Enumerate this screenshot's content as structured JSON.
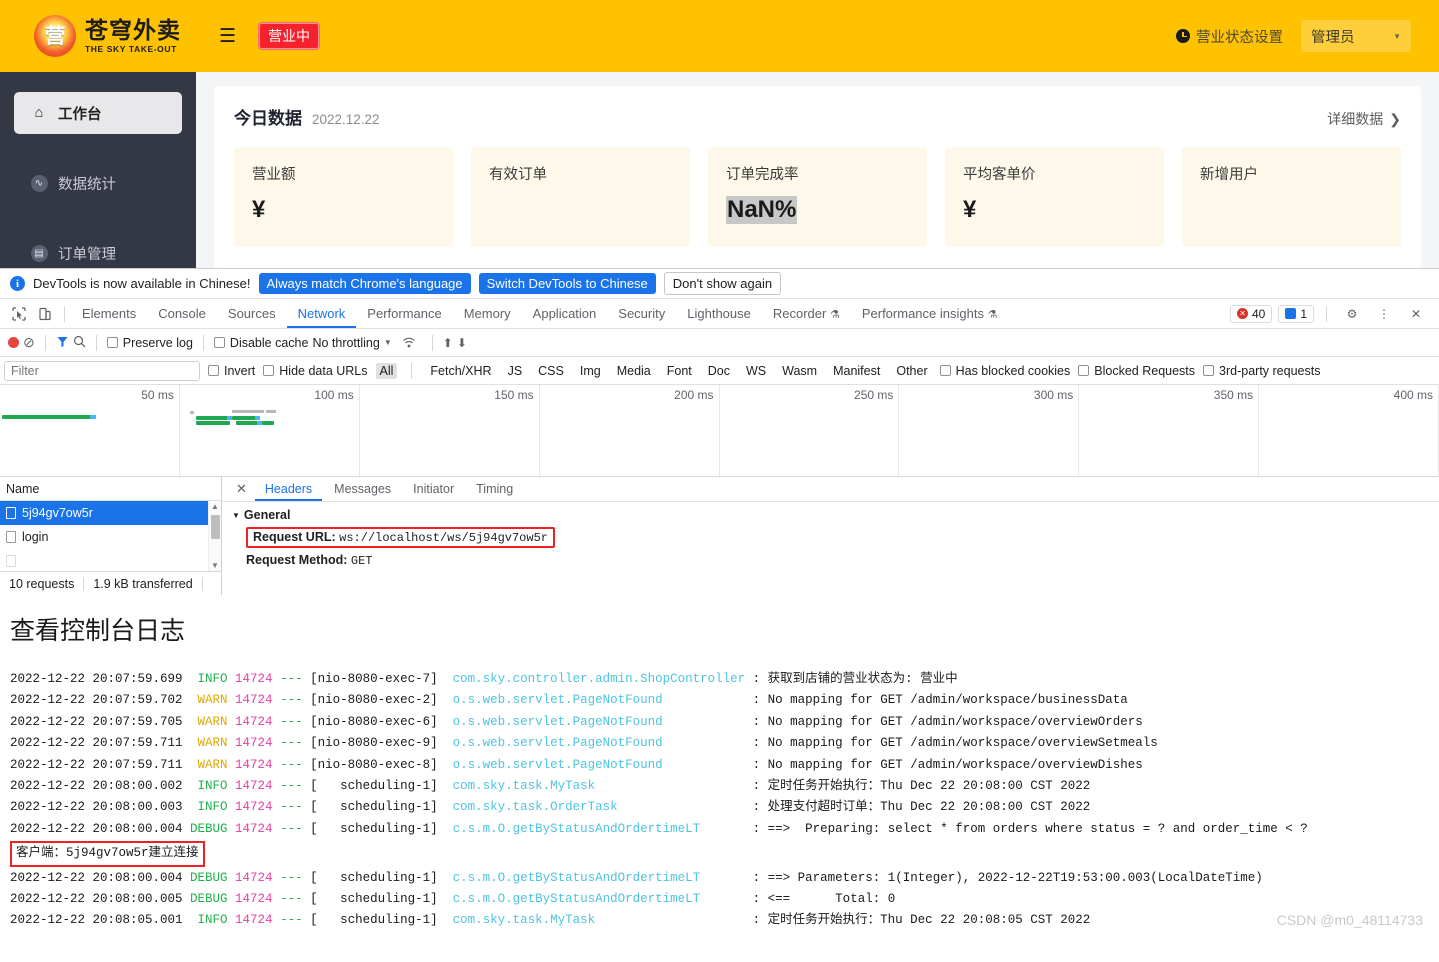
{
  "app": {
    "brand": {
      "logo_glyph": "营",
      "cn": "苍穹外卖",
      "en": "THE SKY TAKE-OUT"
    },
    "hamburger": "☰",
    "status_pill": "营业中",
    "business_status_setting": "营业状态设置",
    "user_role": "管理员",
    "sidebar": {
      "items": [
        {
          "label": "工作台",
          "icon": "home-icon",
          "active": true
        },
        {
          "label": "数据统计",
          "icon": "chart-icon",
          "active": false
        },
        {
          "label": "订单管理",
          "icon": "clipboard-icon",
          "active": false
        }
      ]
    },
    "dashboard": {
      "title": "今日数据",
      "date": "2022.12.22",
      "detail_link": "详细数据",
      "detail_chevron": "❯",
      "cards": [
        {
          "label": "营业额",
          "value": "¥",
          "selected": false
        },
        {
          "label": "有效订单",
          "value": "",
          "selected": false
        },
        {
          "label": "订单完成率",
          "value": "NaN%",
          "selected": true
        },
        {
          "label": "平均客单价",
          "value": "¥",
          "selected": false
        },
        {
          "label": "新增用户",
          "value": "",
          "selected": false
        }
      ]
    }
  },
  "devtools": {
    "notice": {
      "text": "DevTools is now available in Chinese!",
      "btn_always": "Always match Chrome's language",
      "btn_switch": "Switch DevTools to Chinese",
      "btn_dismiss": "Don't show again"
    },
    "tabs": [
      {
        "label": "Elements",
        "active": false
      },
      {
        "label": "Console",
        "active": false
      },
      {
        "label": "Sources",
        "active": false
      },
      {
        "label": "Network",
        "active": true
      },
      {
        "label": "Performance",
        "active": false
      },
      {
        "label": "Memory",
        "active": false
      },
      {
        "label": "Application",
        "active": false
      },
      {
        "label": "Security",
        "active": false
      },
      {
        "label": "Lighthouse",
        "active": false
      },
      {
        "label": "Recorder",
        "active": false,
        "beaker": "⚗"
      },
      {
        "label": "Performance insights",
        "active": false,
        "beaker": "⚗"
      }
    ],
    "badges": {
      "errors": "40",
      "messages": "1"
    },
    "tab_icons": {
      "settings": "⚙",
      "more": "⋮",
      "close": "✕"
    },
    "toolbar": {
      "record": "record-button",
      "clear": "⊘",
      "filter": "filter-icon",
      "search": "⚲",
      "preserve_log": "Preserve log",
      "disable_cache": "Disable cache",
      "throttling": "No throttling",
      "caret": "▼",
      "wifi": "wifi-icon",
      "import": "⬆",
      "export": "⬇"
    },
    "filterbar": {
      "placeholder": "Filter",
      "invert": "Invert",
      "hide_data_urls": "Hide data URLs",
      "types": [
        "All",
        "Fetch/XHR",
        "JS",
        "CSS",
        "Img",
        "Media",
        "Font",
        "Doc",
        "WS",
        "Wasm",
        "Manifest",
        "Other"
      ],
      "active_type": "All",
      "has_blocked_cookies": "Has blocked cookies",
      "blocked_requests": "Blocked Requests",
      "third_party": "3rd-party requests"
    },
    "overview": {
      "ticks": [
        "50 ms",
        "100 ms",
        "150 ms",
        "200 ms",
        "250 ms",
        "300 ms",
        "350 ms",
        "400 ms"
      ]
    },
    "requests": {
      "column_name": "Name",
      "rows": [
        {
          "name": "5j94gv7ow5r",
          "selected": true
        },
        {
          "name": "login",
          "selected": false
        }
      ],
      "footer_count": "10 requests",
      "footer_transferred": "1.9 kB transferred"
    },
    "detail": {
      "tabs": [
        {
          "label": "Headers",
          "active": true
        },
        {
          "label": "Messages",
          "active": false
        },
        {
          "label": "Initiator",
          "active": false
        },
        {
          "label": "Timing",
          "active": false
        }
      ],
      "section_general": "General",
      "request_url_key": "Request URL:",
      "request_url_val": "ws://localhost/ws/5j94gv7ow5r",
      "request_method_key": "Request Method:",
      "request_method_val": "GET"
    }
  },
  "log": {
    "title": "查看控制台日志",
    "note": "客户端：5j94gv7ow5r建立连接",
    "watermark": "CSDN @m0_48114733",
    "lines": [
      {
        "time": "2022-12-22 20:07:59.699",
        "level": "INFO",
        "pid": "14724",
        "thread": "[nio-8080-exec-7]",
        "class": "com.sky.controller.admin.ShopController",
        "msg": ": 获取到店铺的营业状态为: 营业中"
      },
      {
        "time": "2022-12-22 20:07:59.702",
        "level": "WARN",
        "pid": "14724",
        "thread": "[nio-8080-exec-2]",
        "class": "o.s.web.servlet.PageNotFound",
        "msg": ": No mapping for GET /admin/workspace/businessData"
      },
      {
        "time": "2022-12-22 20:07:59.705",
        "level": "WARN",
        "pid": "14724",
        "thread": "[nio-8080-exec-6]",
        "class": "o.s.web.servlet.PageNotFound",
        "msg": ": No mapping for GET /admin/workspace/overviewOrders"
      },
      {
        "time": "2022-12-22 20:07:59.711",
        "level": "WARN",
        "pid": "14724",
        "thread": "[nio-8080-exec-9]",
        "class": "o.s.web.servlet.PageNotFound",
        "msg": ": No mapping for GET /admin/workspace/overviewSetmeals"
      },
      {
        "time": "2022-12-22 20:07:59.711",
        "level": "WARN",
        "pid": "14724",
        "thread": "[nio-8080-exec-8]",
        "class": "o.s.web.servlet.PageNotFound",
        "msg": ": No mapping for GET /admin/workspace/overviewDishes"
      },
      {
        "time": "2022-12-22 20:08:00.002",
        "level": "INFO",
        "pid": "14724",
        "thread": "[   scheduling-1]",
        "class": "com.sky.task.MyTask",
        "msg": ": 定时任务开始执行：Thu Dec 22 20:08:00 CST 2022"
      },
      {
        "time": "2022-12-22 20:08:00.003",
        "level": "INFO",
        "pid": "14724",
        "thread": "[   scheduling-1]",
        "class": "com.sky.task.OrderTask",
        "msg": ": 处理支付超时订单：Thu Dec 22 20:08:00 CST 2022"
      },
      {
        "time": "2022-12-22 20:08:00.004",
        "level": "DEBUG",
        "pid": "14724",
        "thread": "[   scheduling-1]",
        "class": "c.s.m.O.getByStatusAndOrdertimeLT",
        "msg": ": ==>  Preparing: select * from orders where status = ? and order_time < ?"
      },
      {
        "time": "2022-12-22 20:08:00.004",
        "level": "DEBUG",
        "pid": "14724",
        "thread": "[   scheduling-1]",
        "class": "c.s.m.O.getByStatusAndOrdertimeLT",
        "msg": ": ==> Parameters: 1(Integer), 2022-12-22T19:53:00.003(LocalDateTime)"
      },
      {
        "time": "2022-12-22 20:08:00.005",
        "level": "DEBUG",
        "pid": "14724",
        "thread": "[   scheduling-1]",
        "class": "c.s.m.O.getByStatusAndOrdertimeLT",
        "msg": ": <==      Total: 0"
      },
      {
        "time": "2022-12-22 20:08:05.001",
        "level": "INFO",
        "pid": "14724",
        "thread": "[   scheduling-1]",
        "class": "com.sky.task.MyTask",
        "msg": ": 定时任务开始执行：Thu Dec 22 20:08:05 CST 2022"
      }
    ]
  }
}
